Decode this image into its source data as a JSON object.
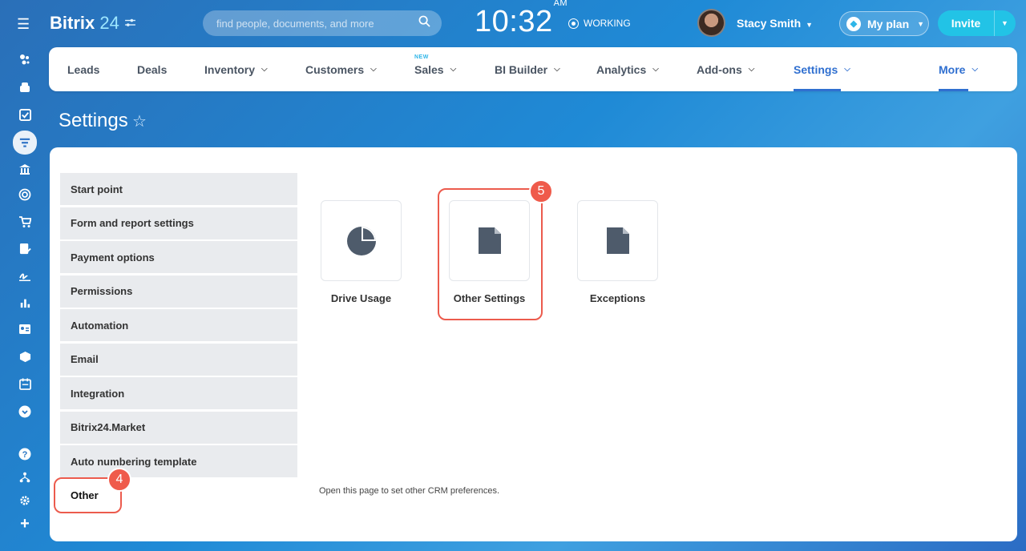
{
  "app": {
    "logo_text": "Bitrix",
    "logo_num": "24",
    "search_placeholder": "find people, documents, and more",
    "clock_time": "10:32",
    "clock_ampm": "AM",
    "status": "WORKING",
    "user_name": "Stacy Smith",
    "plan_label": "My plan",
    "invite_label": "Invite"
  },
  "nav": {
    "items": [
      {
        "label": "Leads"
      },
      {
        "label": "Deals"
      },
      {
        "label": "Inventory"
      },
      {
        "label": "Customers"
      },
      {
        "label": "Sales",
        "tag": "NEW"
      },
      {
        "label": "BI Builder"
      },
      {
        "label": "Analytics"
      },
      {
        "label": "Add-ons"
      },
      {
        "label": "Settings"
      },
      {
        "label": "More"
      }
    ]
  },
  "page": {
    "title": "Settings"
  },
  "sidebar_menu": {
    "items": [
      {
        "label": "Start point"
      },
      {
        "label": "Form and report settings"
      },
      {
        "label": "Payment options"
      },
      {
        "label": "Permissions"
      },
      {
        "label": "Automation"
      },
      {
        "label": "Email"
      },
      {
        "label": "Integration"
      },
      {
        "label": "Bitrix24.Market"
      },
      {
        "label": "Auto numbering template"
      },
      {
        "label": "Other"
      }
    ]
  },
  "tiles": [
    {
      "label": "Drive Usage",
      "icon": "pie-chart-icon"
    },
    {
      "label": "Other Settings",
      "icon": "document-icon"
    },
    {
      "label": "Exceptions",
      "icon": "document-icon"
    }
  ],
  "annotations": {
    "step_other": "4",
    "step_other_settings": "5"
  },
  "hint": "Open this page to set other CRM preferences.",
  "colors": {
    "accent": "#2f6fd0",
    "highlight": "#ec5b4d",
    "invite": "#22c3e6"
  }
}
